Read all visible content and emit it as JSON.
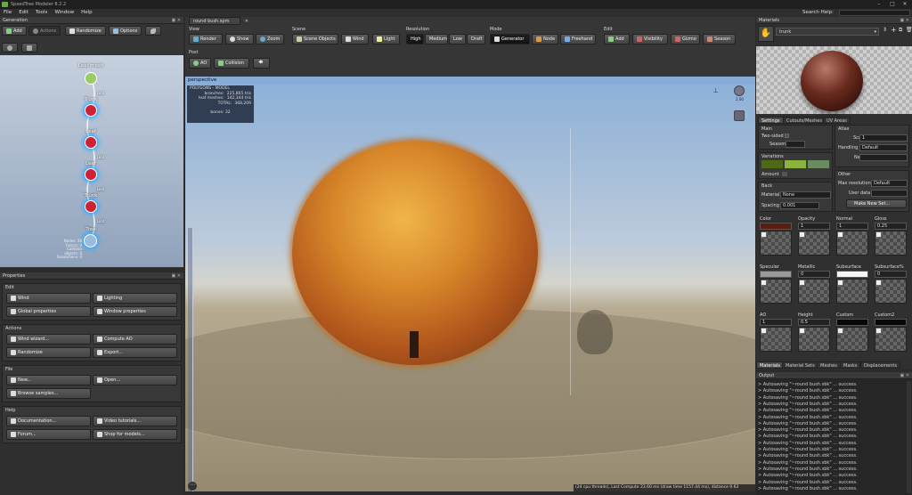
{
  "window": {
    "title": "SpeedTree Modeler 8.2.2",
    "search_help": "Search Help:"
  },
  "menu": [
    "File",
    "Edit",
    "Tools",
    "Window",
    "Help"
  ],
  "generation": {
    "title": "Generation",
    "toolbar": [
      "Add",
      "Actions",
      "Randomize",
      "Options"
    ],
    "nodes": [
      {
        "label": "Leaf mesh"
      },
      {
        "label": "Trunk"
      },
      {
        "label": "Leaf"
      },
      {
        "label": "Leaf"
      },
      {
        "label": "Trunk"
      },
      {
        "label": "Tree"
      }
    ],
    "small_labels": [
      "Leaf",
      "Leaf",
      "Leaf",
      "Leaf"
    ],
    "stats": [
      "Nodes: 38",
      "Forces: 0",
      "Collision objects: 0",
      "Resolutions: 4"
    ]
  },
  "properties": {
    "title": "Properties",
    "sections": [
      {
        "label": "Edit",
        "buttons": [
          "Wind",
          "Lighting",
          "Global properties",
          "Window properties"
        ]
      },
      {
        "label": "Actions",
        "buttons": [
          "Wind wizard...",
          "Compute AO",
          "Randomize",
          "Export..."
        ]
      },
      {
        "label": "File",
        "buttons": [
          "New...",
          "Open...",
          "Browse samples..."
        ]
      },
      {
        "label": "Help",
        "buttons": [
          "Documentation...",
          "Video tutorials...",
          "Forum...",
          "Shop for models..."
        ]
      }
    ]
  },
  "document_tab": "round bush.spm",
  "toolbar": {
    "view": {
      "label": "View",
      "buttons": [
        "Render",
        "Show",
        "Zoom"
      ]
    },
    "scene": {
      "label": "Scene",
      "buttons": [
        "Scene Objects",
        "Wind",
        "Light"
      ]
    },
    "resolution": {
      "label": "Resolution",
      "buttons": [
        "High",
        "Medium",
        "Low",
        "Draft"
      ],
      "selected": "High"
    },
    "mode": {
      "label": "Mode",
      "buttons": [
        "Generator",
        "Node",
        "Freehand"
      ],
      "selected": "Generator"
    },
    "edit": {
      "label": "Edit",
      "buttons": [
        "Add",
        "Visibility",
        "Gizmo",
        "Season"
      ]
    },
    "post": {
      "label": "Post",
      "buttons": [
        "AO",
        "Collision"
      ]
    }
  },
  "viewport": {
    "label": "perspective",
    "stats_title": "POLYGONS - MODEL",
    "stats": [
      {
        "k": "branches:",
        "v": "225,865 tris"
      },
      {
        "k": "leaf meshes:",
        "v": "142,344 tris"
      },
      {
        "k": "TOTAL:",
        "v": "368,209"
      }
    ],
    "bones": "bones: 32",
    "scale_label": "2.00",
    "status": "(24 cpu threads), Last Compute 23.60 ms (draw time 1157.44 ms), distance 9.63"
  },
  "materials": {
    "title": "Materials",
    "selected": "trunk",
    "tabs": [
      "Settings",
      "Cutouts/Meshes",
      "UV Areas"
    ],
    "main": {
      "label": "Main",
      "two_sided": "Two-sided",
      "season": "Season"
    },
    "atlas": {
      "label": "Atlas",
      "scale_label": "Scale",
      "scale": "1",
      "handling_label": "Handling",
      "handling": "Default",
      "name_label": "Name"
    },
    "variations": {
      "label": "Variations",
      "amount": "Amount",
      "colors": [
        "#4e6a14",
        "#8ab43c",
        "#6a8a60"
      ]
    },
    "back": {
      "label": "Back",
      "material_label": "Material",
      "material": "None",
      "spacing_label": "Spacing",
      "spacing": "0.001"
    },
    "other": {
      "label": "Other",
      "maxres_label": "Max resolution",
      "maxres": "Default",
      "userdata": "User data",
      "make_set": "Make New Set..."
    },
    "slots": [
      {
        "name": "Color",
        "value": "",
        "swatch": "#5a1e10"
      },
      {
        "name": "Opacity",
        "value": "1"
      },
      {
        "name": "Normal",
        "value": "1"
      },
      {
        "name": "Gloss",
        "value": "0.25"
      },
      {
        "name": "Specular",
        "value": "",
        "swatch": "#9a9a9a"
      },
      {
        "name": "Metallic",
        "value": "0"
      },
      {
        "name": "Subsurface",
        "value": "",
        "swatch": "#f5f5f5"
      },
      {
        "name": "Subsurface%",
        "value": "0"
      },
      {
        "name": "AO",
        "value": "1"
      },
      {
        "name": "Height",
        "value": "0.5"
      },
      {
        "name": "Custom",
        "value": "",
        "swatch": "#080808"
      },
      {
        "name": "Custom2",
        "value": "",
        "swatch": "#080808"
      }
    ],
    "bottom_tabs": [
      "Materials",
      "Material Sets",
      "Meshes",
      "Masks",
      "Displacements"
    ]
  },
  "output": {
    "title": "Output",
    "line": "> Autosaving \"~round bush.sbk\" ... success.",
    "count": 17
  }
}
